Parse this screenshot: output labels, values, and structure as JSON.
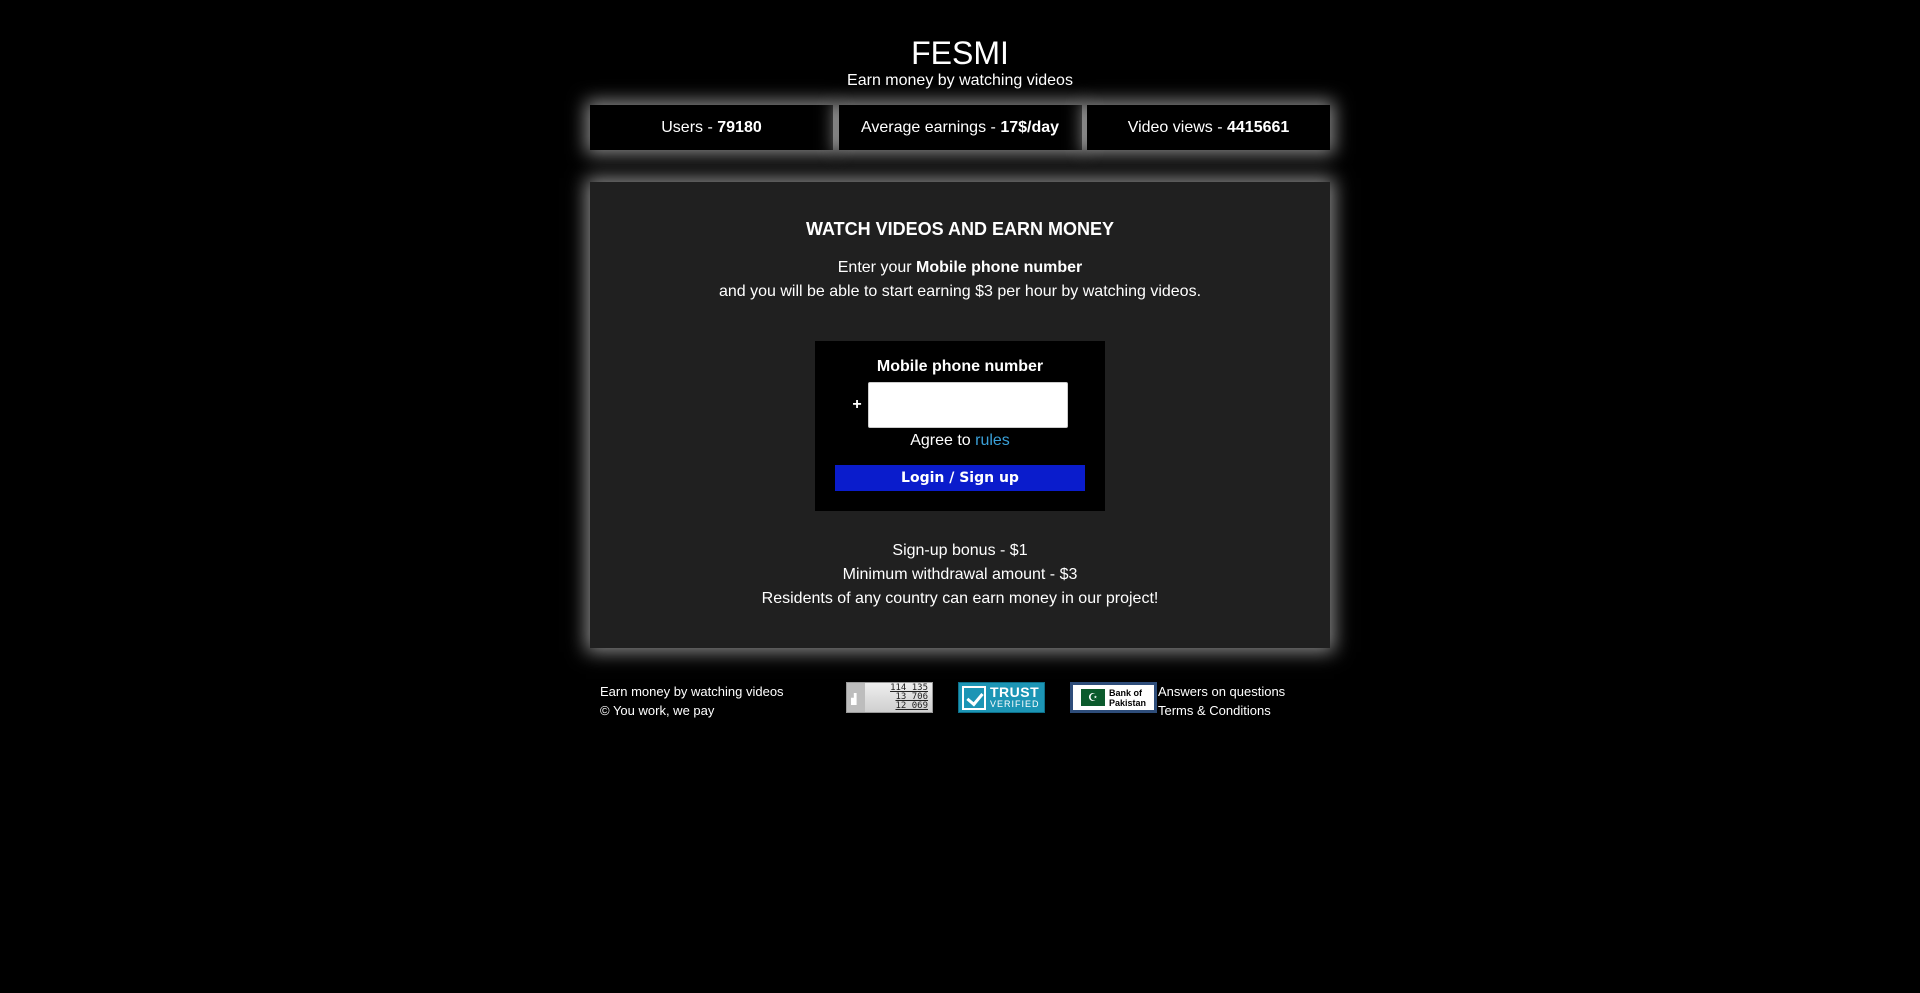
{
  "header": {
    "title": "FESMI",
    "tagline": "Earn money by watching videos"
  },
  "stats": [
    {
      "label": "Users - ",
      "value": "79180"
    },
    {
      "label": "Average earnings - ",
      "value": "17$/day"
    },
    {
      "label": "Video views - ",
      "value": "4415661"
    }
  ],
  "panel": {
    "heading": "WATCH VIDEOS AND EARN MONEY",
    "intro_prefix": "Enter your ",
    "intro_bold": "Mobile phone number",
    "intro_line2": "and you will be able to start earning $3 per hour by watching videos."
  },
  "form": {
    "label": "Mobile phone number",
    "plus": "+",
    "phone_value": "",
    "agree_prefix": "Agree to ",
    "rules_link": "rules",
    "submit_label": "Login / Sign up"
  },
  "info": {
    "bonus": "Sign-up bonus - $1",
    "min_withdrawal": "Minimum withdrawal amount - $3",
    "residents": "Residents of any country can earn money in our project!"
  },
  "footer": {
    "tagline": "Earn money by watching videos",
    "copyright": "© You work, we pay",
    "counter_values": [
      "114 135",
      "13 706",
      "12 069"
    ],
    "trust_title": "TRUST",
    "trust_sub": "VERIFIED",
    "bank_flag": "☪",
    "bank_line1": "Bank of",
    "bank_line2": "Pakistan",
    "link_answers": "Answers on questions",
    "link_terms": "Terms & Conditions"
  },
  "colors": {
    "background": "#000000",
    "panel": "#202020",
    "button": "#0a1ccc",
    "link": "#3aa0d8"
  }
}
